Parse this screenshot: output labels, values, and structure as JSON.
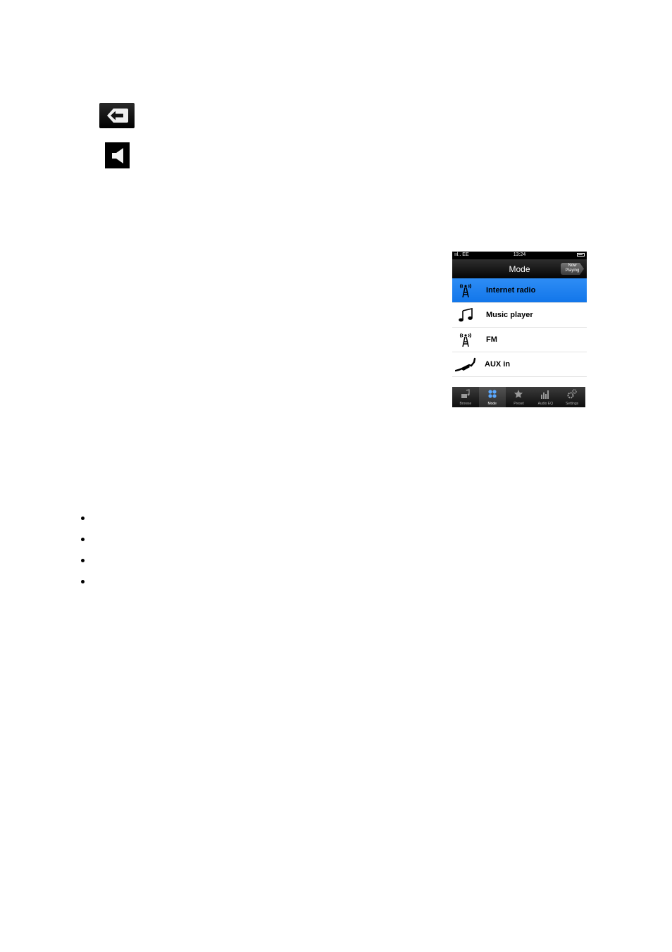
{
  "phone": {
    "status": {
      "carrier": "ııl.. EE",
      "time": "13:24"
    },
    "nav": {
      "title": "Mode",
      "now_playing": [
        "Now",
        "Playing"
      ]
    },
    "modes": [
      {
        "label": "Internet radio",
        "icon": "radio-tower-icon",
        "selected": true
      },
      {
        "label": "Music player",
        "icon": "music-note-icon",
        "selected": false
      },
      {
        "label": "FM",
        "icon": "radio-tower-icon",
        "selected": false
      },
      {
        "label": "AUX in",
        "icon": "aux-cable-icon",
        "selected": false
      }
    ],
    "tabs": [
      {
        "label": "Browse",
        "icon": "browse-icon"
      },
      {
        "label": "Mode",
        "icon": "mode-icon",
        "active": true
      },
      {
        "label": "Preset",
        "icon": "star-icon"
      },
      {
        "label": "Audio EQ",
        "icon": "equalizer-icon"
      },
      {
        "label": "Settings",
        "icon": "gear-icon"
      }
    ],
    "colors": {
      "selected_row": "#1a7ff0",
      "bar": "#000000"
    }
  }
}
